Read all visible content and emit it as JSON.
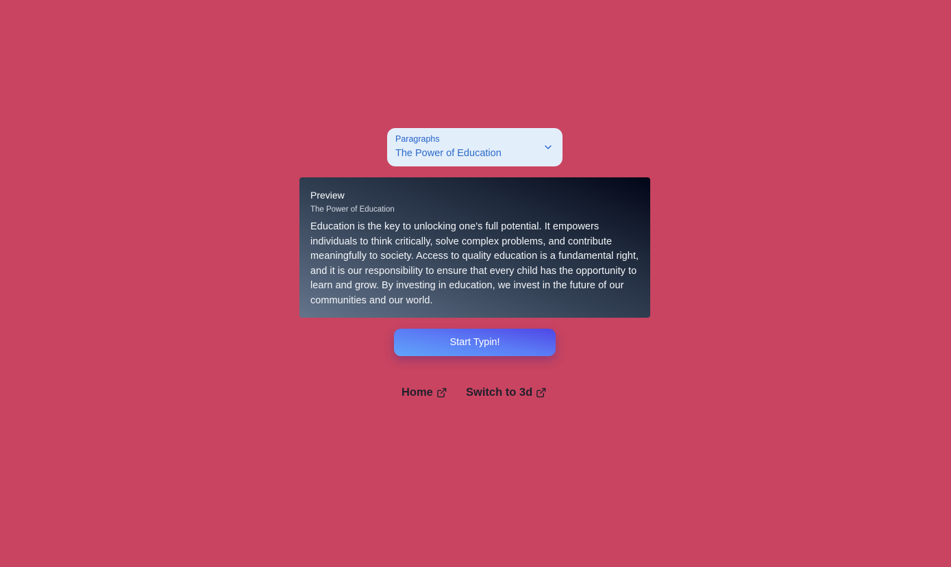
{
  "select": {
    "label": "Paragraphs",
    "value": "The Power of Education",
    "icon": "chevron-down-icon"
  },
  "preview": {
    "heading": "Preview",
    "subtitle": "The Power of Education",
    "text": "Education is the key to unlocking one's full potential. It empowers individuals to think critically, solve complex problems, and contribute meaningfully to society. Access to quality education is a fundamental right, and it is our responsibility to ensure that every child has the opportunity to learn and grow. By investing in education, we invest in the future of our communities and our world."
  },
  "start_button": {
    "label": "Start Typin!"
  },
  "links": {
    "home": "Home",
    "switch": "Switch to 3d",
    "icon": "external-link-icon"
  },
  "colors": {
    "background": "#c84460",
    "select_bg": "#e3eefb",
    "select_text": "#2a6ac8",
    "button_start": "#60a5fa",
    "button_end": "#4f46e5",
    "link_text": "#1f1f2b"
  }
}
